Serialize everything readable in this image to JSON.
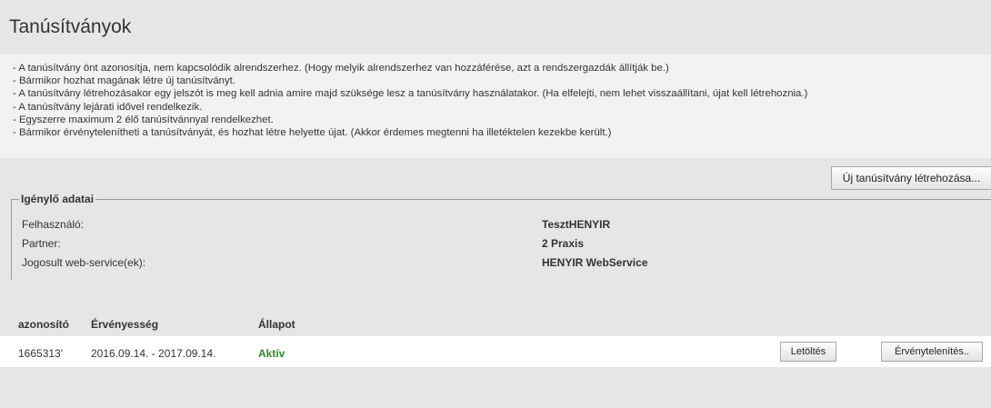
{
  "page": {
    "title": "Tanúsítványok"
  },
  "info": {
    "lines": [
      "- A tanúsítvány önt azonosítja, nem kapcsolódik alrendszerhez. (Hogy melyik alrendszerhez van hozzáférése, azt a rendszergazdák állítják be.)",
      "- Bármikor hozhat magának létre új tanúsítványt.",
      "- A tanúsítvány létrehozásakor egy jelszót is meg kell adnia amire majd szüksége lesz a tanúsítvány használatakor. (Ha elfelejti, nem lehet visszaállítani, újat kell létrehoznia.)",
      "- A tanúsítvány lejárati idővel rendelkezik.",
      "- Egyszerre maximum 2 élő tanúsítvánnyal rendelkezhet.",
      "- Bármikor érvénytelenítheti a tanúsítványát, és hozhat létre helyette újat. (Akkor érdemes megtenni ha illetéktelen kezekbe került.)"
    ]
  },
  "actions": {
    "new_certificate": "Új tanúsítvány létrehozása..."
  },
  "applicant": {
    "legend": "Igénylő adatai",
    "fields": [
      {
        "label": "Felhasználó:",
        "value": "TesztHENYIR"
      },
      {
        "label": "Partner:",
        "value": "2 Praxis"
      },
      {
        "label": "Jogosult web-service(ek):",
        "value": "HENYIR WebService"
      }
    ]
  },
  "table": {
    "headers": [
      "azonosító",
      "Érvényesség",
      "Állapot"
    ],
    "rows": [
      {
        "id": "1665313'",
        "validity": "2016.09.14. - 2017.09.14.",
        "status": "Aktív",
        "download": "Letöltés",
        "invalidate": "Érvénytelenítés.."
      }
    ]
  }
}
